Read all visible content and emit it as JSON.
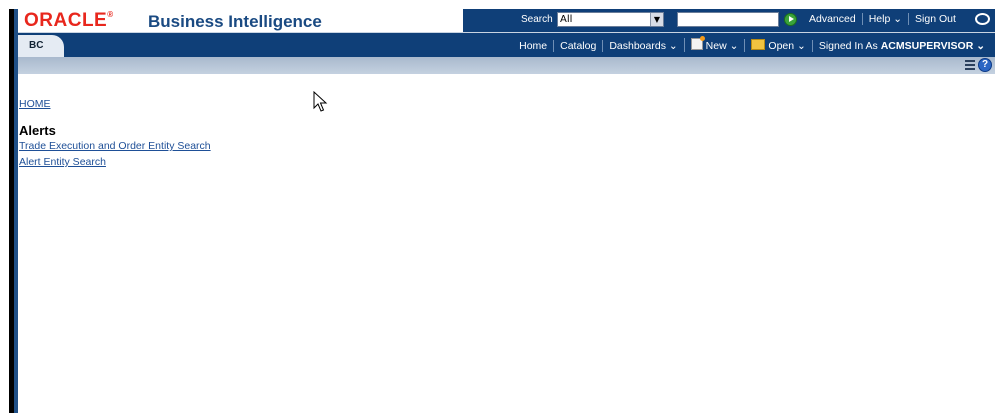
{
  "header": {
    "logo_text": "ORACLE",
    "product_name": "Business Intelligence",
    "search_label": "Search",
    "search_scope": "All",
    "top_links": [
      "Advanced",
      "Help ⌄",
      "Sign Out"
    ]
  },
  "nav": {
    "tab_label": "BC",
    "home": "Home",
    "catalog": "Catalog",
    "dashboards": "Dashboards ⌄",
    "new": "New ⌄",
    "open": "Open ⌄",
    "signed_in_prefix": "Signed In As",
    "signed_in_user": "ACMSUPERVISOR ⌄"
  },
  "content": {
    "breadcrumb_home": "HOME",
    "section_title": "Alerts",
    "links": [
      "Trade Execution and Order Entity Search",
      "Alert Entity Search"
    ]
  },
  "colors": {
    "brand_red": "#e8271d",
    "header_blue": "#0f3f78",
    "link_blue": "#1e4f97"
  }
}
